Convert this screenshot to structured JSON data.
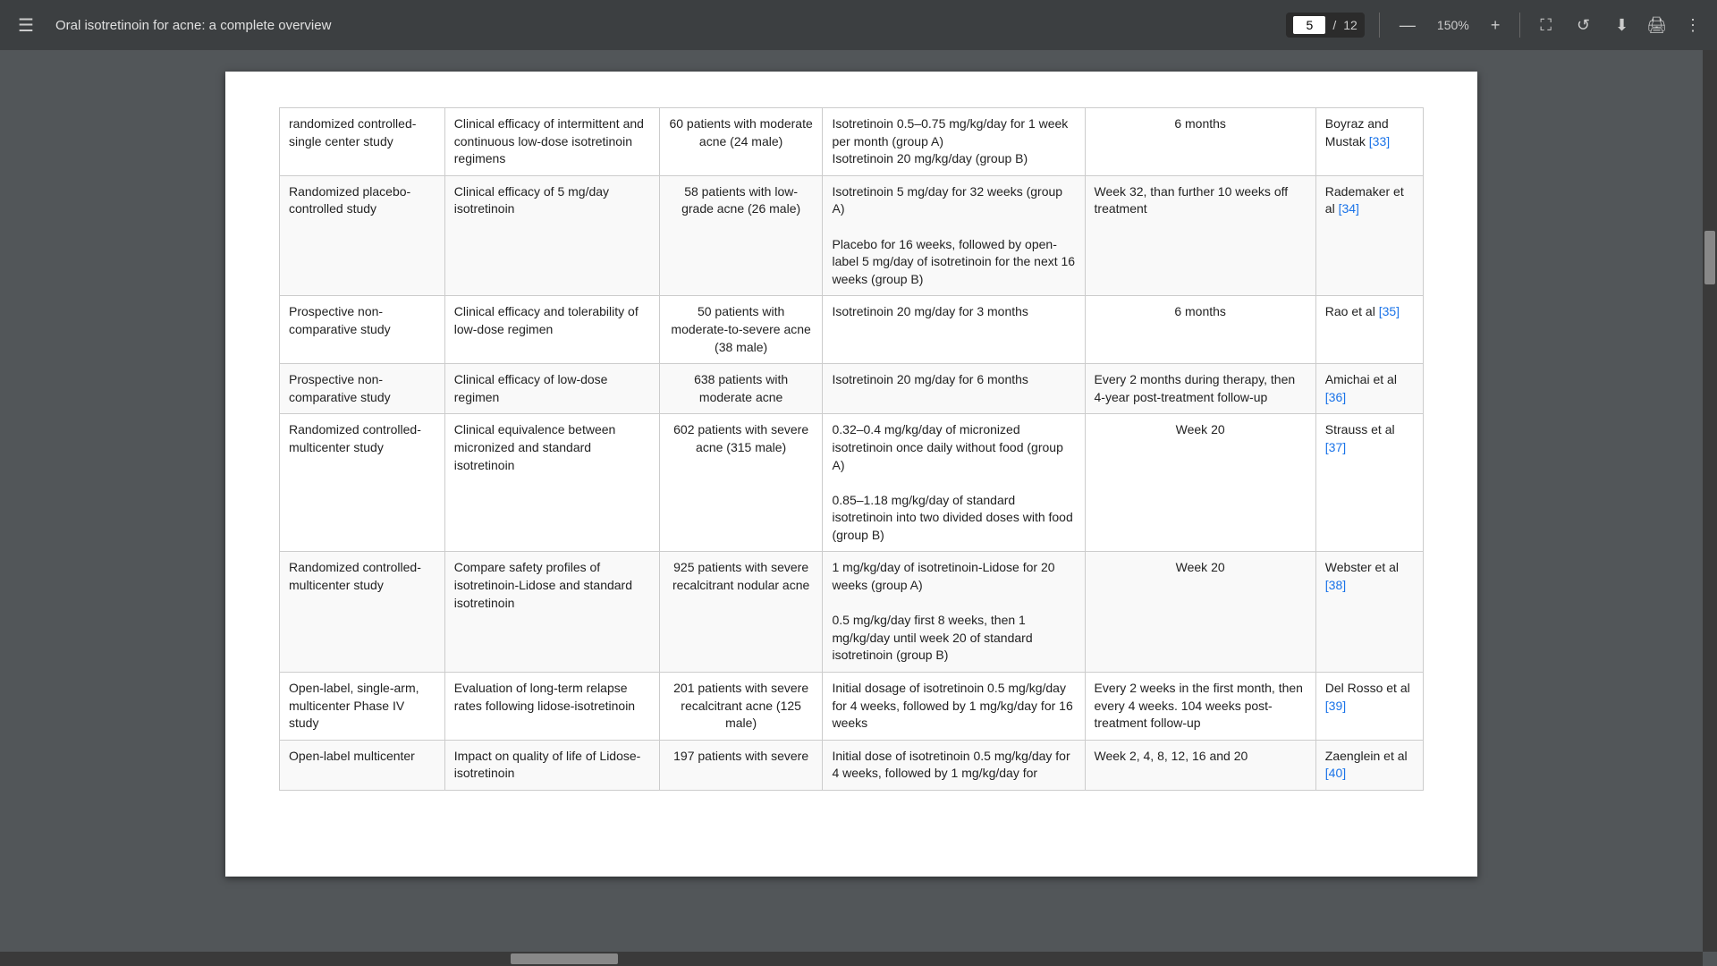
{
  "toolbar": {
    "menu_icon": "☰",
    "title": "Oral isotretinoin for acne: a complete overview",
    "current_page": "5",
    "total_pages": "12",
    "zoom_level": "150%",
    "zoom_in_label": "+",
    "zoom_out_label": "—",
    "download_icon": "⬇",
    "print_icon": "🖨",
    "more_icon": "⋮",
    "fit_icon": "⛶",
    "history_icon": "↺"
  },
  "table": {
    "rows": [
      {
        "study_type": "randomized controlled-single center study",
        "objective": "Clinical efficacy of intermittent and continuous low-dose isotretinoin regimens",
        "patients": "60 patients with moderate acne (24 male)",
        "treatment": "Isotretinoin 0.5–0.75 mg/kg/day for 1 week per month (group A)\nIsotretinoin 20 mg/kg/day (group B)",
        "followup": "6 months",
        "reference": "Boyraz and Mustak [33]"
      },
      {
        "study_type": "Randomized placebo-controlled study",
        "objective": "Clinical efficacy of 5 mg/day isotretinoin",
        "patients": "58 patients with low-grade acne (26 male)",
        "treatment": "Isotretinoin 5 mg/day for 32 weeks (group A)\nPlacebo for 16 weeks, followed by open-label 5 mg/day of isotretinoin for the next 16 weeks (group B)",
        "followup": "Week 32, than further 10 weeks off treatment",
        "reference": "Rademaker et al [34]"
      },
      {
        "study_type": "Prospective non-comparative study",
        "objective": "Clinical efficacy and tolerability of low-dose regimen",
        "patients": "50 patients with moderate-to-severe acne (38 male)",
        "treatment": "Isotretinoin 20 mg/day for 3 months",
        "followup": "6 months",
        "reference": "Rao et al [35]"
      },
      {
        "study_type": "Prospective non-comparative study",
        "objective": "Clinical efficacy of low-dose regimen",
        "patients": "638 patients with moderate acne",
        "treatment": "Isotretinoin 20 mg/day for 6 months",
        "followup": "Every 2 months during therapy, then 4-year post-treatment follow-up",
        "reference": "Amichai et al [36]"
      },
      {
        "study_type": "Randomized controlled-multicenter study",
        "objective": "Clinical equivalence between micronized and standard isotretinoin",
        "patients": "602 patients with severe acne (315 male)",
        "treatment": "0.32–0.4 mg/kg/day of micronized isotretinoin once daily without food (group A)\n0.85–1.18 mg/kg/day of standard isotretinoin into two divided doses with food (group B)",
        "followup": "Week 20",
        "reference": "Strauss et al [37]"
      },
      {
        "study_type": "Randomized controlled-multicenter study",
        "objective": "Compare safety profiles of isotretinoin-Lidose and standard isotretinoin",
        "patients": "925 patients with severe recalcitrant nodular acne",
        "treatment": "1 mg/kg/day of isotretinoin-Lidose for 20 weeks (group A)\n0.5 mg/kg/day first 8 weeks, then 1 mg/kg/day until week 20 of standard isotretinoin (group B)",
        "followup": "Week 20",
        "reference": "Webster et al [38]"
      },
      {
        "study_type": "Open-label, single-arm, multicenter Phase IV study",
        "objective": "Evaluation of long-term relapse rates following lidose-isotretinoin",
        "patients": "201 patients with severe recalcitrant acne (125 male)",
        "treatment": "Initial dosage of isotretinoin 0.5 mg/kg/day for 4 weeks, followed by 1 mg/kg/day for 16 weeks",
        "followup": "Every 2 weeks in the first month, then every 4 weeks. 104 weeks post-treatment follow-up",
        "reference": "Del Rosso et al [39]"
      },
      {
        "study_type": "Open-label multicenter",
        "objective": "Impact on quality of life of Lidose-isotretinoin",
        "patients": "197 patients with severe",
        "treatment": "Initial dose of isotretinoin 0.5 mg/kg/day for 4 weeks, followed by 1 mg/kg/day for",
        "followup": "Week 2, 4, 8, 12, 16 and 20",
        "reference": "Zaenglein et al [40]"
      }
    ]
  }
}
